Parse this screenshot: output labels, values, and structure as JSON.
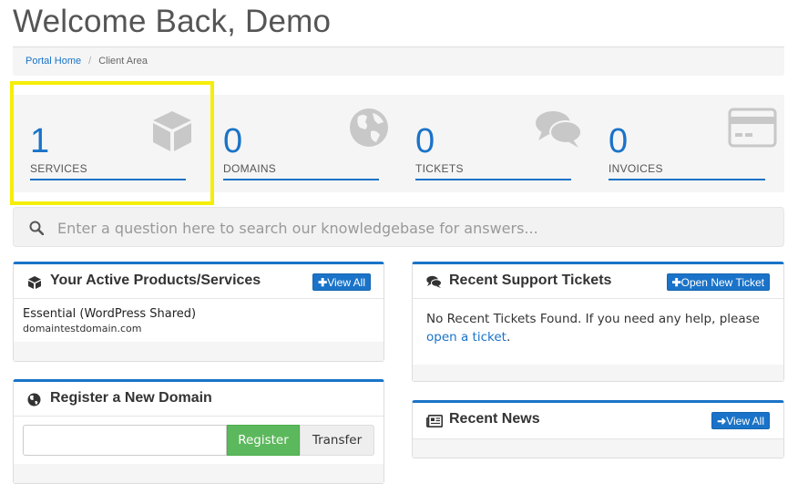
{
  "header": {
    "title": "Welcome Back, Demo"
  },
  "breadcrumb": {
    "home": "Portal Home",
    "separator": "/",
    "current": "Client Area"
  },
  "stats": [
    {
      "count": "1",
      "label": "SERVICES",
      "icon": "cube-icon"
    },
    {
      "count": "0",
      "label": "DOMAINS",
      "icon": "globe-icon"
    },
    {
      "count": "0",
      "label": "TICKETS",
      "icon": "comments-icon"
    },
    {
      "count": "0",
      "label": "INVOICES",
      "icon": "credit-card-icon"
    }
  ],
  "kb_search": {
    "placeholder": "Enter a question here to search our knowledgebase for answers..."
  },
  "products_panel": {
    "title": "Your Active Products/Services",
    "button": "View All",
    "items": [
      {
        "name": "Essential (WordPress Shared)",
        "domain": "domaintestdomain.com"
      }
    ]
  },
  "tickets_panel": {
    "title": "Recent Support Tickets",
    "button": "Open New Ticket",
    "text": "No Recent Tickets Found. If you need any help, please",
    "link": "open a ticket",
    "text_end": "."
  },
  "domain_panel": {
    "title": "Register a New Domain",
    "input_value": "",
    "register_label": "Register",
    "transfer_label": "Transfer"
  },
  "news_panel": {
    "title": "Recent News",
    "button": "View All"
  },
  "colors": {
    "accent": "#1a73c8",
    "success": "#5cb85c",
    "highlight": "#f5ee08",
    "icon_gray": "#c8c8c8"
  }
}
